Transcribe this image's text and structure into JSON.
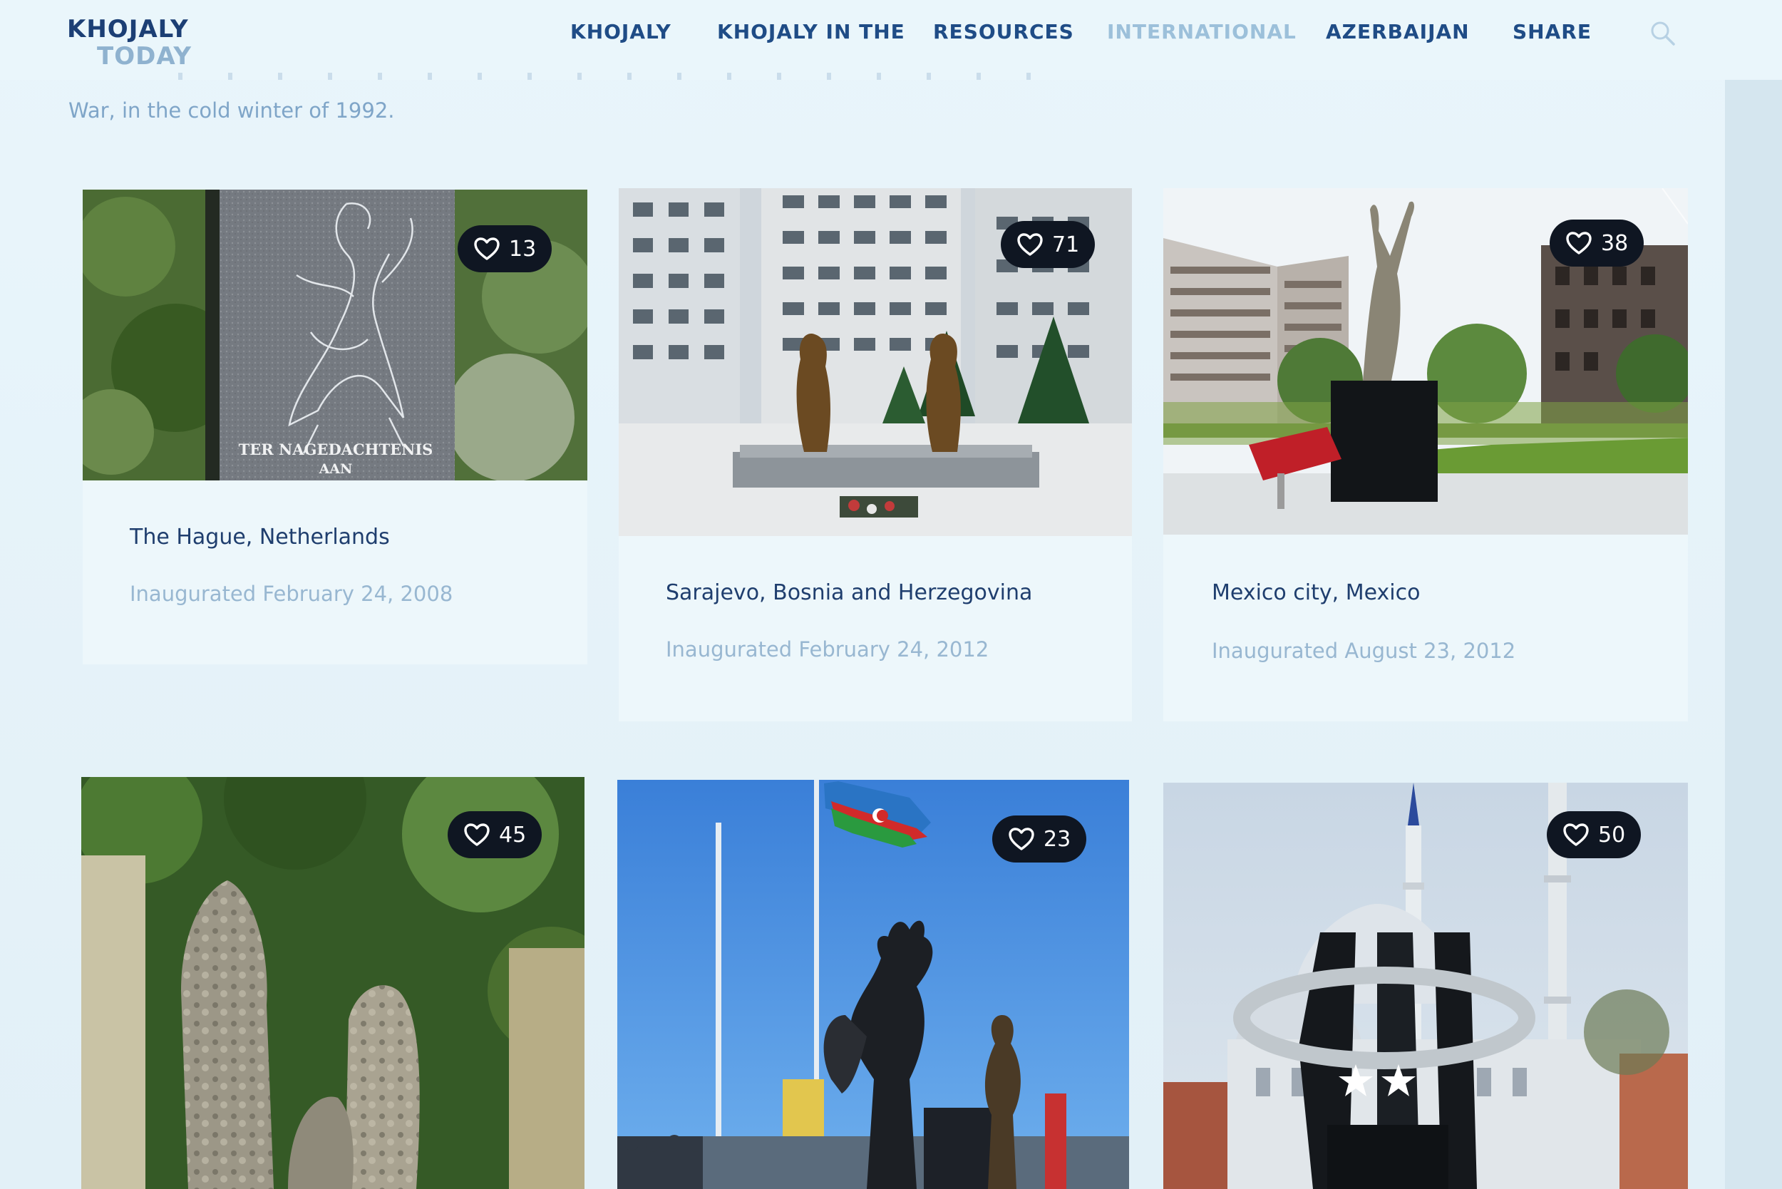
{
  "site": {
    "logo_line1": "KHOJALY",
    "logo_line2": "TODAY"
  },
  "nav": {
    "items": [
      {
        "label": "KHOJALY",
        "state": "normal"
      },
      {
        "label": "KHOJALY IN THE",
        "state": "normal"
      },
      {
        "label": "RESOURCES",
        "state": "normal"
      },
      {
        "label": "INTERNATIONAL",
        "state": "active"
      },
      {
        "label": "AZERBAIJAN",
        "state": "normal"
      },
      {
        "label": "SHARE",
        "state": "normal"
      }
    ],
    "search_icon": "search-icon"
  },
  "intro": {
    "text": "War, in the cold winter of 1992."
  },
  "cards": [
    {
      "title": "The Hague, Netherlands",
      "date": "Inaugurated February 24, 2008",
      "likes": "13",
      "inscription": "TER NAGEDACHTENIS AAN"
    },
    {
      "title": "Sarajevo, Bosnia and Herzegovina",
      "date": "Inaugurated February 24, 2012",
      "likes": "71"
    },
    {
      "title": "Mexico city, Mexico",
      "date": "Inaugurated August 23, 2012",
      "likes": "38"
    },
    {
      "title": "",
      "date": "",
      "likes": "45"
    },
    {
      "title": "",
      "date": "",
      "likes": "23"
    },
    {
      "title": "",
      "date": "",
      "likes": "50"
    }
  ],
  "colors": {
    "nav_text": "#1f4c86",
    "nav_active": "#9cc0da",
    "like_badge": "#0f1622",
    "title": "#1f3e6e",
    "date": "#98b7d1"
  }
}
